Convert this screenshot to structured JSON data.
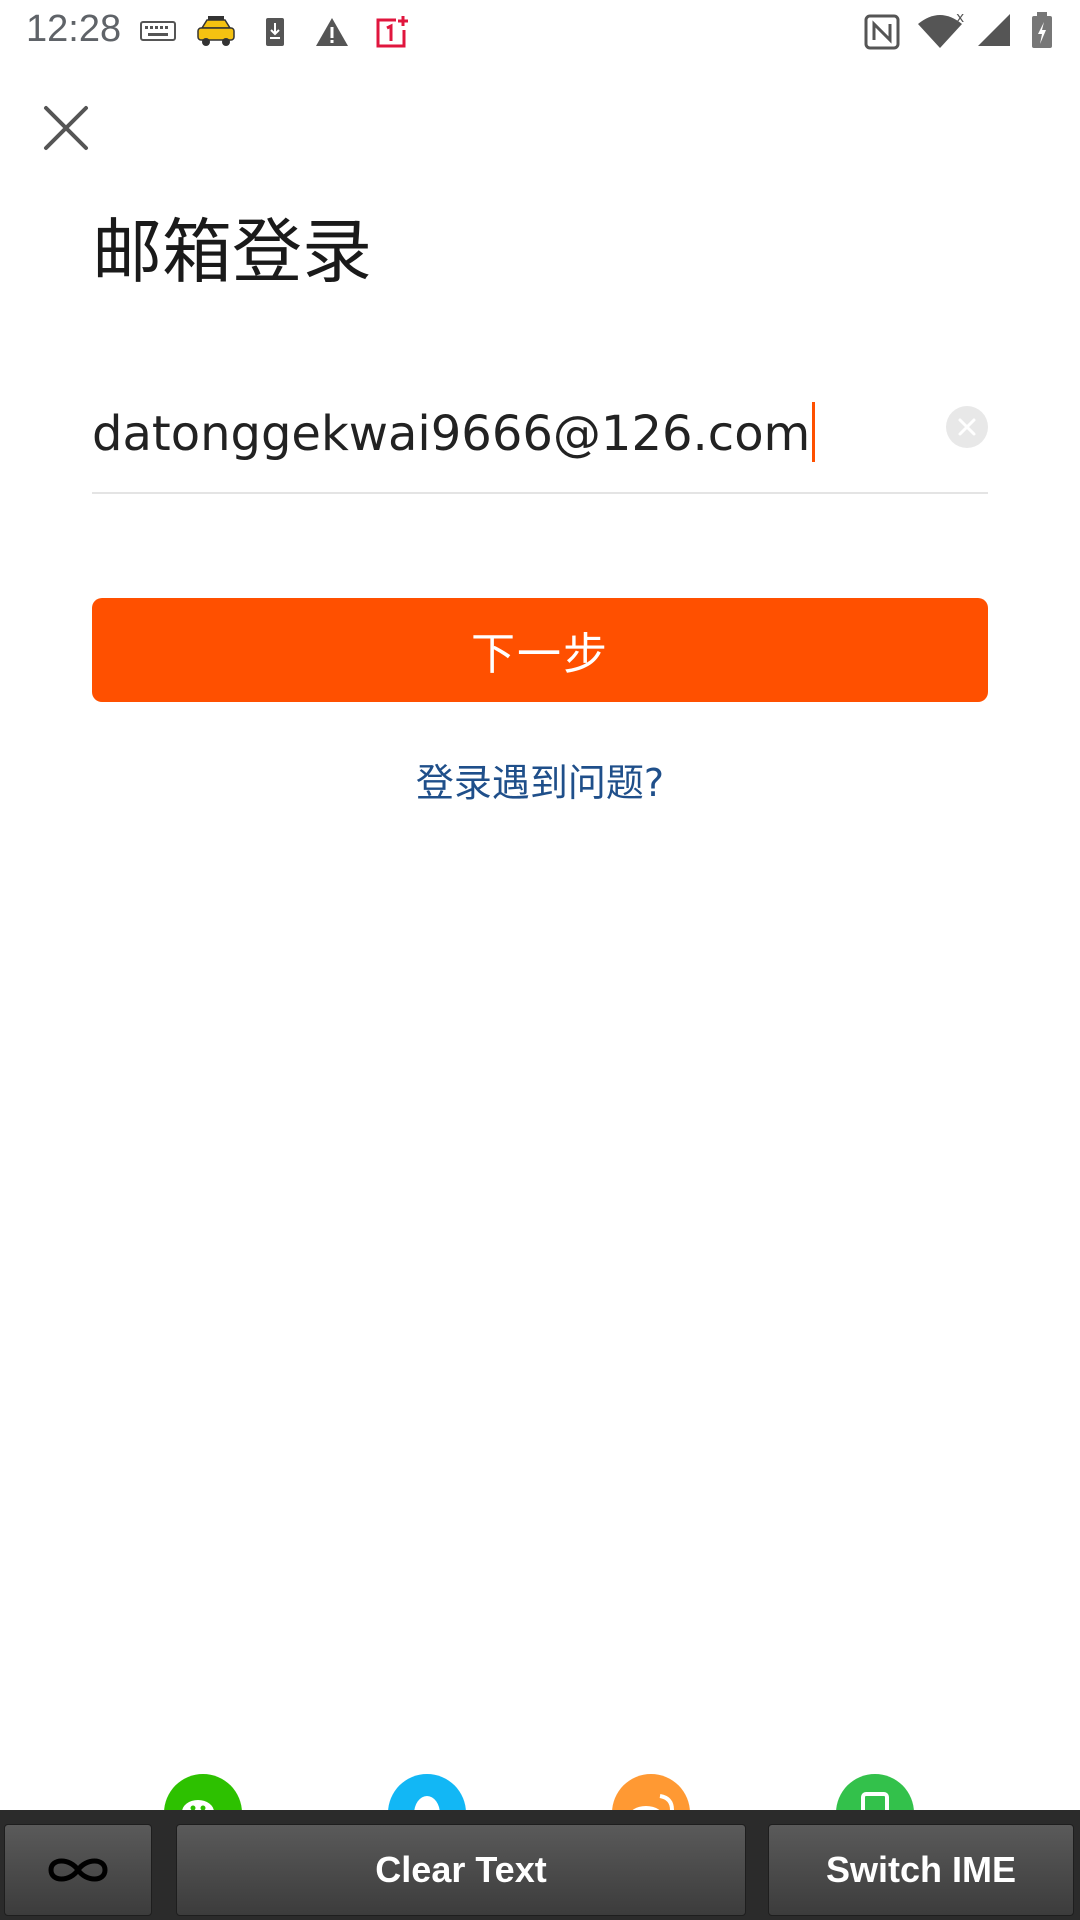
{
  "status_bar": {
    "time": "12:28",
    "icons": [
      "keyboard-icon",
      "taxi-icon",
      "download-icon",
      "warning-icon",
      "oneplus-icon",
      "nfc-icon",
      "wifi-icon",
      "signal-icon",
      "battery-icon"
    ]
  },
  "page": {
    "title": "邮箱登录",
    "email_value": "datonggekwai9666@126.com",
    "next_button": "下一步",
    "help_link": "登录遇到问题?"
  },
  "social": [
    "wechat-icon",
    "qq-icon",
    "weibo-icon",
    "phone-icon"
  ],
  "colors": {
    "accent": "#ff5000",
    "link": "#1f4f8a",
    "social_wechat": "#2dc100",
    "social_qq": "#12b7f5",
    "social_weibo": "#ff9933",
    "social_phone": "#33c14b"
  },
  "bottom_bar": {
    "clear_text": "Clear Text",
    "switch_ime": "Switch IME"
  }
}
